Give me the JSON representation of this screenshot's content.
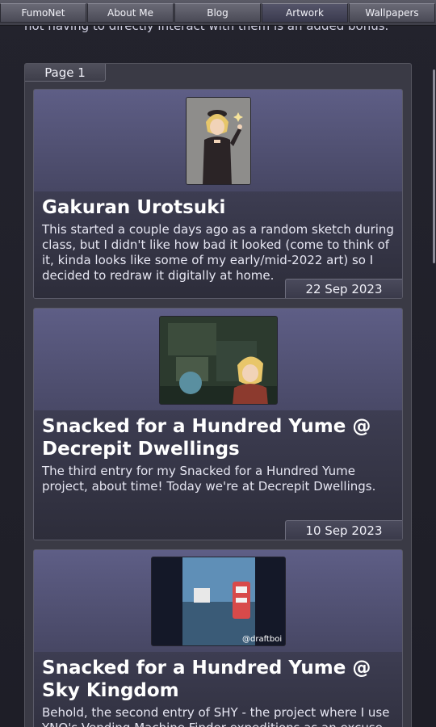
{
  "intro": {
    "text": "not having to directly interact with them is an added bonus."
  },
  "nav": {
    "items": [
      {
        "label": "FumoNet"
      },
      {
        "label": "About Me"
      },
      {
        "label": "Blog"
      },
      {
        "label": "Artwork"
      },
      {
        "label": "Wallpapers"
      }
    ],
    "active": "Artwork"
  },
  "page": {
    "tab_label": "Page 1"
  },
  "posts": [
    {
      "title": "Gakuran Urotsuki",
      "description": "This started a couple days ago as a random sketch during class, but I didn't like how bad it looked (come to think of it, kinda looks like some of my early/mid-2022 art) so I decided to redraw it digitally at home.",
      "date": "22 Sep 2023"
    },
    {
      "title": "Snacked for a Hundred Yume @ Decrepit Dwellings",
      "description": "The third entry for my Snacked for a Hundred Yume project, about time! Today we're at Decrepit Dwellings.",
      "date": "10 Sep 2023"
    },
    {
      "title": "Snacked for a Hundred Yume @ Sky Kingdom",
      "description": "Behold, the second entry of SHY - the project where I use YNO's Vending Machine Finder expeditions as an excuse",
      "date": ""
    }
  ],
  "images": {
    "post3_signature": "@draftboi"
  },
  "colors": {
    "background": "#1f1f28",
    "card": "#505076",
    "accent": "#5a5a84"
  }
}
